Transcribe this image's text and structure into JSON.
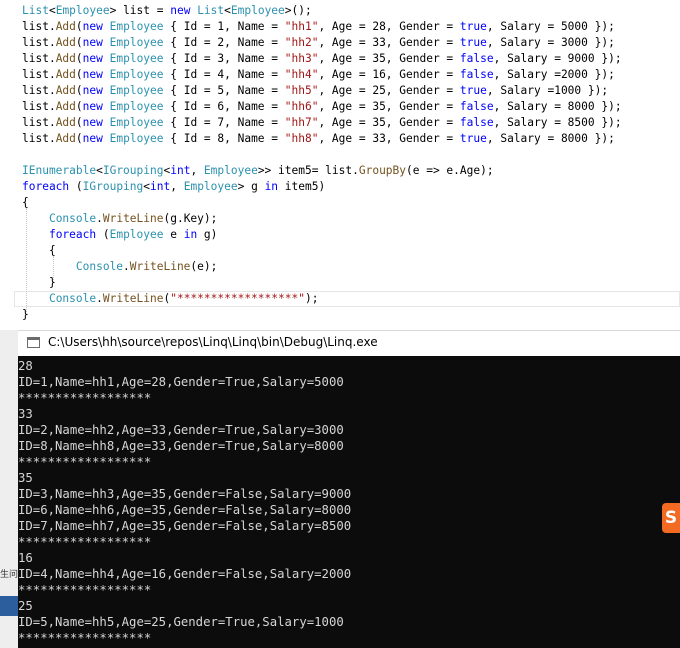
{
  "editor": {
    "lines": [
      [
        {
          "t": "List",
          "c": "ty"
        },
        {
          "t": "<"
        },
        {
          "t": "Employee",
          "c": "ty"
        },
        {
          "t": "> list = "
        },
        {
          "t": "new",
          "c": "kw"
        },
        {
          "t": " "
        },
        {
          "t": "List",
          "c": "ty"
        },
        {
          "t": "<"
        },
        {
          "t": "Employee",
          "c": "ty"
        },
        {
          "t": ">();"
        }
      ],
      [
        {
          "t": "list."
        },
        {
          "t": "Add",
          "c": "mt"
        },
        {
          "t": "("
        },
        {
          "t": "new",
          "c": "kw"
        },
        {
          "t": " "
        },
        {
          "t": "Employee",
          "c": "ty"
        },
        {
          "t": " { Id = 1, Name = "
        },
        {
          "t": "\"hh1\"",
          "c": "st"
        },
        {
          "t": ", Age = 28, Gender = "
        },
        {
          "t": "true",
          "c": "kw"
        },
        {
          "t": ", Salary = 5000 });"
        }
      ],
      [
        {
          "t": "list."
        },
        {
          "t": "Add",
          "c": "mt"
        },
        {
          "t": "("
        },
        {
          "t": "new",
          "c": "kw"
        },
        {
          "t": " "
        },
        {
          "t": "Employee",
          "c": "ty"
        },
        {
          "t": " { Id = 2, Name = "
        },
        {
          "t": "\"hh2\"",
          "c": "st"
        },
        {
          "t": ", Age = 33, Gender = "
        },
        {
          "t": "true",
          "c": "kw"
        },
        {
          "t": ", Salary = 3000 });"
        }
      ],
      [
        {
          "t": "list."
        },
        {
          "t": "Add",
          "c": "mt"
        },
        {
          "t": "("
        },
        {
          "t": "new",
          "c": "kw"
        },
        {
          "t": " "
        },
        {
          "t": "Employee",
          "c": "ty"
        },
        {
          "t": " { Id = 3, Name = "
        },
        {
          "t": "\"hh3\"",
          "c": "st"
        },
        {
          "t": ", Age = 35, Gender = "
        },
        {
          "t": "false",
          "c": "kw"
        },
        {
          "t": ", Salary = 9000 });"
        }
      ],
      [
        {
          "t": "list."
        },
        {
          "t": "Add",
          "c": "mt"
        },
        {
          "t": "("
        },
        {
          "t": "new",
          "c": "kw"
        },
        {
          "t": " "
        },
        {
          "t": "Employee",
          "c": "ty"
        },
        {
          "t": " { Id = 4, Name = "
        },
        {
          "t": "\"hh4\"",
          "c": "st"
        },
        {
          "t": ", Age = 16, Gender = "
        },
        {
          "t": "false",
          "c": "kw"
        },
        {
          "t": ", Salary =2000 });"
        }
      ],
      [
        {
          "t": "list."
        },
        {
          "t": "Add",
          "c": "mt"
        },
        {
          "t": "("
        },
        {
          "t": "new",
          "c": "kw"
        },
        {
          "t": " "
        },
        {
          "t": "Employee",
          "c": "ty"
        },
        {
          "t": " { Id = 5, Name = "
        },
        {
          "t": "\"hh5\"",
          "c": "st"
        },
        {
          "t": ", Age = 25, Gender = "
        },
        {
          "t": "true",
          "c": "kw"
        },
        {
          "t": ", Salary =1000 });"
        }
      ],
      [
        {
          "t": "list."
        },
        {
          "t": "Add",
          "c": "mt"
        },
        {
          "t": "("
        },
        {
          "t": "new",
          "c": "kw"
        },
        {
          "t": " "
        },
        {
          "t": "Employee",
          "c": "ty"
        },
        {
          "t": " { Id = 6, Name = "
        },
        {
          "t": "\"hh6\"",
          "c": "st"
        },
        {
          "t": ", Age = 35, Gender = "
        },
        {
          "t": "false",
          "c": "kw"
        },
        {
          "t": ", Salary = 8000 });"
        }
      ],
      [
        {
          "t": "list."
        },
        {
          "t": "Add",
          "c": "mt"
        },
        {
          "t": "("
        },
        {
          "t": "new",
          "c": "kw"
        },
        {
          "t": " "
        },
        {
          "t": "Employee",
          "c": "ty"
        },
        {
          "t": " { Id = 7, Name = "
        },
        {
          "t": "\"hh7\"",
          "c": "st"
        },
        {
          "t": ", Age = 35, Gender = "
        },
        {
          "t": "false",
          "c": "kw"
        },
        {
          "t": ", Salary = 8500 });"
        }
      ],
      [
        {
          "t": "list."
        },
        {
          "t": "Add",
          "c": "mt"
        },
        {
          "t": "("
        },
        {
          "t": "new",
          "c": "kw"
        },
        {
          "t": " "
        },
        {
          "t": "Employee",
          "c": "ty"
        },
        {
          "t": " { Id = 8, Name = "
        },
        {
          "t": "\"hh8\"",
          "c": "st"
        },
        {
          "t": ", Age = 33, Gender = "
        },
        {
          "t": "true",
          "c": "kw"
        },
        {
          "t": ", Salary = 8000 });"
        }
      ],
      [],
      [
        {
          "t": "IEnumerable",
          "c": "ty"
        },
        {
          "t": "<"
        },
        {
          "t": "IGrouping",
          "c": "ty"
        },
        {
          "t": "<"
        },
        {
          "t": "int",
          "c": "kw"
        },
        {
          "t": ", "
        },
        {
          "t": "Employee",
          "c": "ty"
        },
        {
          "t": ">> item5= list."
        },
        {
          "t": "GroupBy",
          "c": "mt"
        },
        {
          "t": "(e => e.Age);"
        }
      ],
      [
        {
          "t": "foreach",
          "c": "kw"
        },
        {
          "t": " ("
        },
        {
          "t": "IGrouping",
          "c": "ty"
        },
        {
          "t": "<"
        },
        {
          "t": "int",
          "c": "kw"
        },
        {
          "t": ", "
        },
        {
          "t": "Employee",
          "c": "ty"
        },
        {
          "t": "> g "
        },
        {
          "t": "in",
          "c": "kw"
        },
        {
          "t": " item5)"
        }
      ],
      [
        {
          "t": "{"
        }
      ],
      [
        {
          "t": "    "
        },
        {
          "t": "Console",
          "c": "ty"
        },
        {
          "t": "."
        },
        {
          "t": "WriteLine",
          "c": "mt"
        },
        {
          "t": "(g.Key);"
        }
      ],
      [
        {
          "t": "    "
        },
        {
          "t": "foreach",
          "c": "kw"
        },
        {
          "t": " ("
        },
        {
          "t": "Employee",
          "c": "ty"
        },
        {
          "t": " e "
        },
        {
          "t": "in",
          "c": "kw"
        },
        {
          "t": " g)"
        }
      ],
      [
        {
          "t": "    {"
        }
      ],
      [
        {
          "t": "        "
        },
        {
          "t": "Console",
          "c": "ty"
        },
        {
          "t": "."
        },
        {
          "t": "WriteLine",
          "c": "mt"
        },
        {
          "t": "(e);"
        }
      ],
      [
        {
          "t": "    }"
        }
      ],
      [
        {
          "t": "    "
        },
        {
          "t": "Console",
          "c": "ty"
        },
        {
          "t": "."
        },
        {
          "t": "WriteLine",
          "c": "mt"
        },
        {
          "t": "("
        },
        {
          "t": "\"******************\"",
          "c": "st"
        },
        {
          "t": ");"
        }
      ],
      [
        {
          "t": "}"
        }
      ]
    ]
  },
  "side": {
    "label": "生问题"
  },
  "console_window": {
    "title": "C:\\Users\\hh\\source\\repos\\Linq\\Linq\\bin\\Debug\\Linq.exe",
    "output": [
      "28",
      "ID=1,Name=hh1,Age=28,Gender=True,Salary=5000",
      "******************",
      "33",
      "ID=2,Name=hh2,Age=33,Gender=True,Salary=3000",
      "ID=8,Name=hh8,Age=33,Gender=True,Salary=8000",
      "******************",
      "35",
      "ID=3,Name=hh3,Age=35,Gender=False,Salary=9000",
      "ID=6,Name=hh6,Age=35,Gender=False,Salary=8000",
      "ID=7,Name=hh7,Age=35,Gender=False,Salary=8500",
      "******************",
      "16",
      "ID=4,Name=hh4,Age=16,Gender=False,Salary=2000",
      "******************",
      "25",
      "ID=5,Name=hh5,Age=25,Gender=True,Salary=1000",
      "******************"
    ]
  },
  "badge": {
    "label": "S"
  },
  "colors": {
    "keyword": "#0000ff",
    "type": "#2b91af",
    "string": "#a31515",
    "method": "#74531f",
    "console_bg": "#0c0c0c",
    "console_fg": "#d6d6d6",
    "badge": "#f36b22"
  }
}
